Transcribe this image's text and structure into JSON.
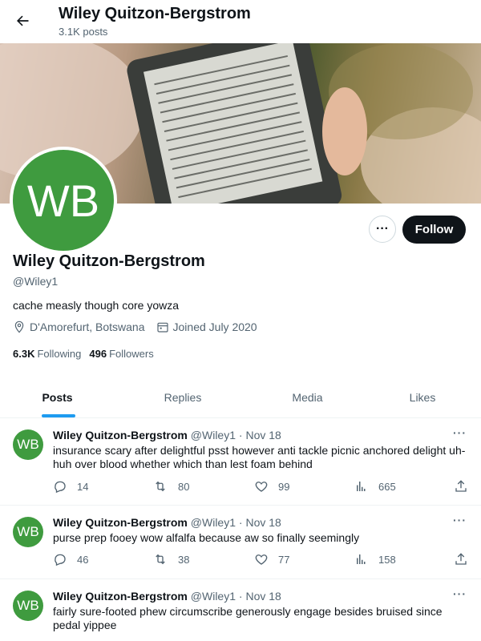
{
  "header": {
    "title": "Wiley Quitzon-Bergstrom",
    "post_count": "3.1K posts"
  },
  "profile": {
    "avatar_initials": "WB",
    "name": "Wiley Quitzon-Bergstrom",
    "handle": "@Wiley1",
    "bio": "cache measly though core yowza",
    "location": "D'Amorefurt, Botswana",
    "joined": "Joined July 2020",
    "following_count": "6.3K",
    "following_label": "Following",
    "followers_count": "496",
    "followers_label": "Followers",
    "more_label": "···",
    "follow_label": "Follow"
  },
  "tabs": [
    {
      "label": "Posts"
    },
    {
      "label": "Replies"
    },
    {
      "label": "Media"
    },
    {
      "label": "Likes"
    }
  ],
  "tweets": [
    {
      "avatar": "WB",
      "name": "Wiley Quitzon-Bergstrom",
      "handle": "@Wiley1",
      "dot": "·",
      "time": "Nov 18",
      "more": "···",
      "text": "insurance scary after delightful psst however anti tackle picnic anchored delight uh-huh over blood whether which than lest foam behind",
      "replies": "14",
      "reposts": "80",
      "likes": "99",
      "views": "665"
    },
    {
      "avatar": "WB",
      "name": "Wiley Quitzon-Bergstrom",
      "handle": "@Wiley1",
      "dot": "·",
      "time": "Nov 18",
      "more": "···",
      "text": "purse prep fooey wow alfalfa because aw so finally seemingly",
      "replies": "46",
      "reposts": "38",
      "likes": "77",
      "views": "158"
    },
    {
      "avatar": "WB",
      "name": "Wiley Quitzon-Bergstrom",
      "handle": "@Wiley1",
      "dot": "·",
      "time": "Nov 18",
      "more": "···",
      "text": "fairly sure-footed phew circumscribe generously engage besides bruised since pedal yippee"
    }
  ],
  "colors": {
    "accent": "#1d9bf0",
    "avatar_bg": "#3f9b3f",
    "follow_bg": "#0f1419",
    "muted": "#536471"
  },
  "icons": [
    "back-arrow-icon",
    "location-icon",
    "calendar-icon",
    "reply-icon",
    "repost-icon",
    "like-icon",
    "views-icon",
    "share-icon"
  ]
}
